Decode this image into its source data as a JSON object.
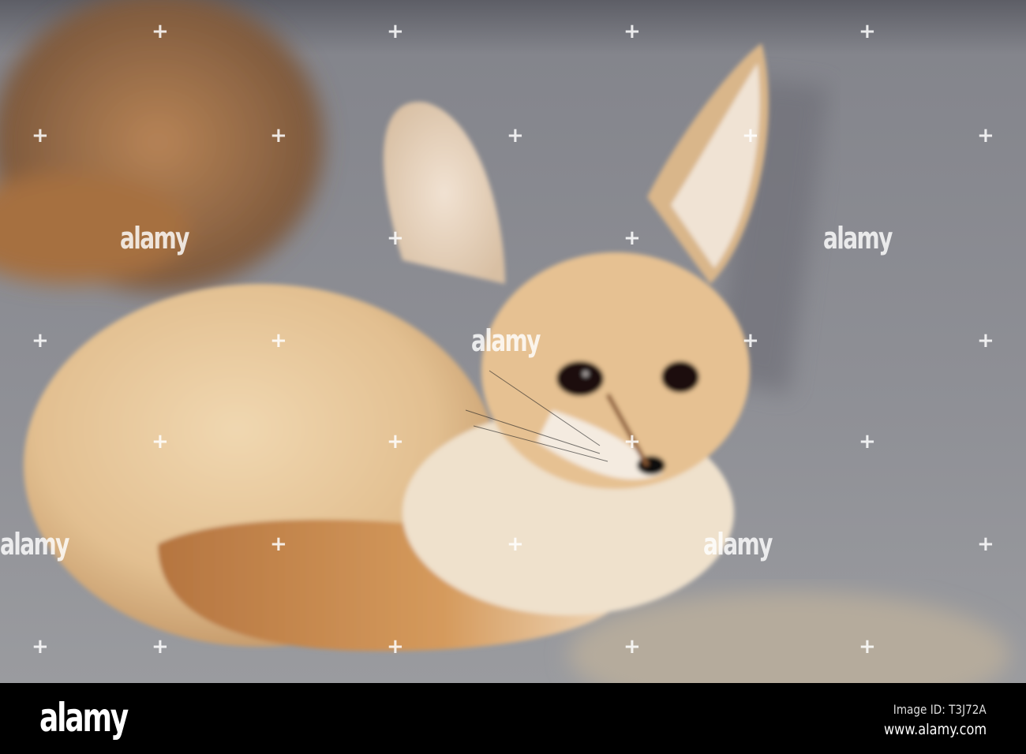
{
  "photo": {
    "subject": "fennec fox",
    "watermark_text": "alamy",
    "colors": {
      "sand": "#8f9096",
      "fur": "#e6c59a",
      "tail": "#c98a4c",
      "footer": "#000000"
    }
  },
  "footer": {
    "logo": "alamy",
    "image_id": "Image ID: T3J72A",
    "website": "www.alamy.com"
  }
}
